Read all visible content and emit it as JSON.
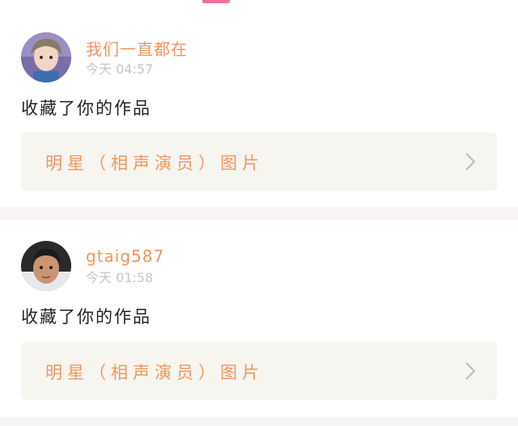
{
  "feed": {
    "items": [
      {
        "username": "我们一直都在",
        "time": "今天 04:57",
        "action": "收藏了你的作品",
        "work_title": "明星（相声演员）图片"
      },
      {
        "username": "gtaig587",
        "time": "今天 01:58",
        "action": "收藏了你的作品",
        "work_title": "明星（相声演员）图片"
      }
    ]
  },
  "colors": {
    "accent": "#f2955d",
    "tab_indicator": "#f06f9a",
    "card_bg": "#f6f5ef",
    "separator": "#f6f4f4",
    "meta_text": "#c5c5c5"
  },
  "icons": {
    "chevron": "chevron-right-icon"
  }
}
